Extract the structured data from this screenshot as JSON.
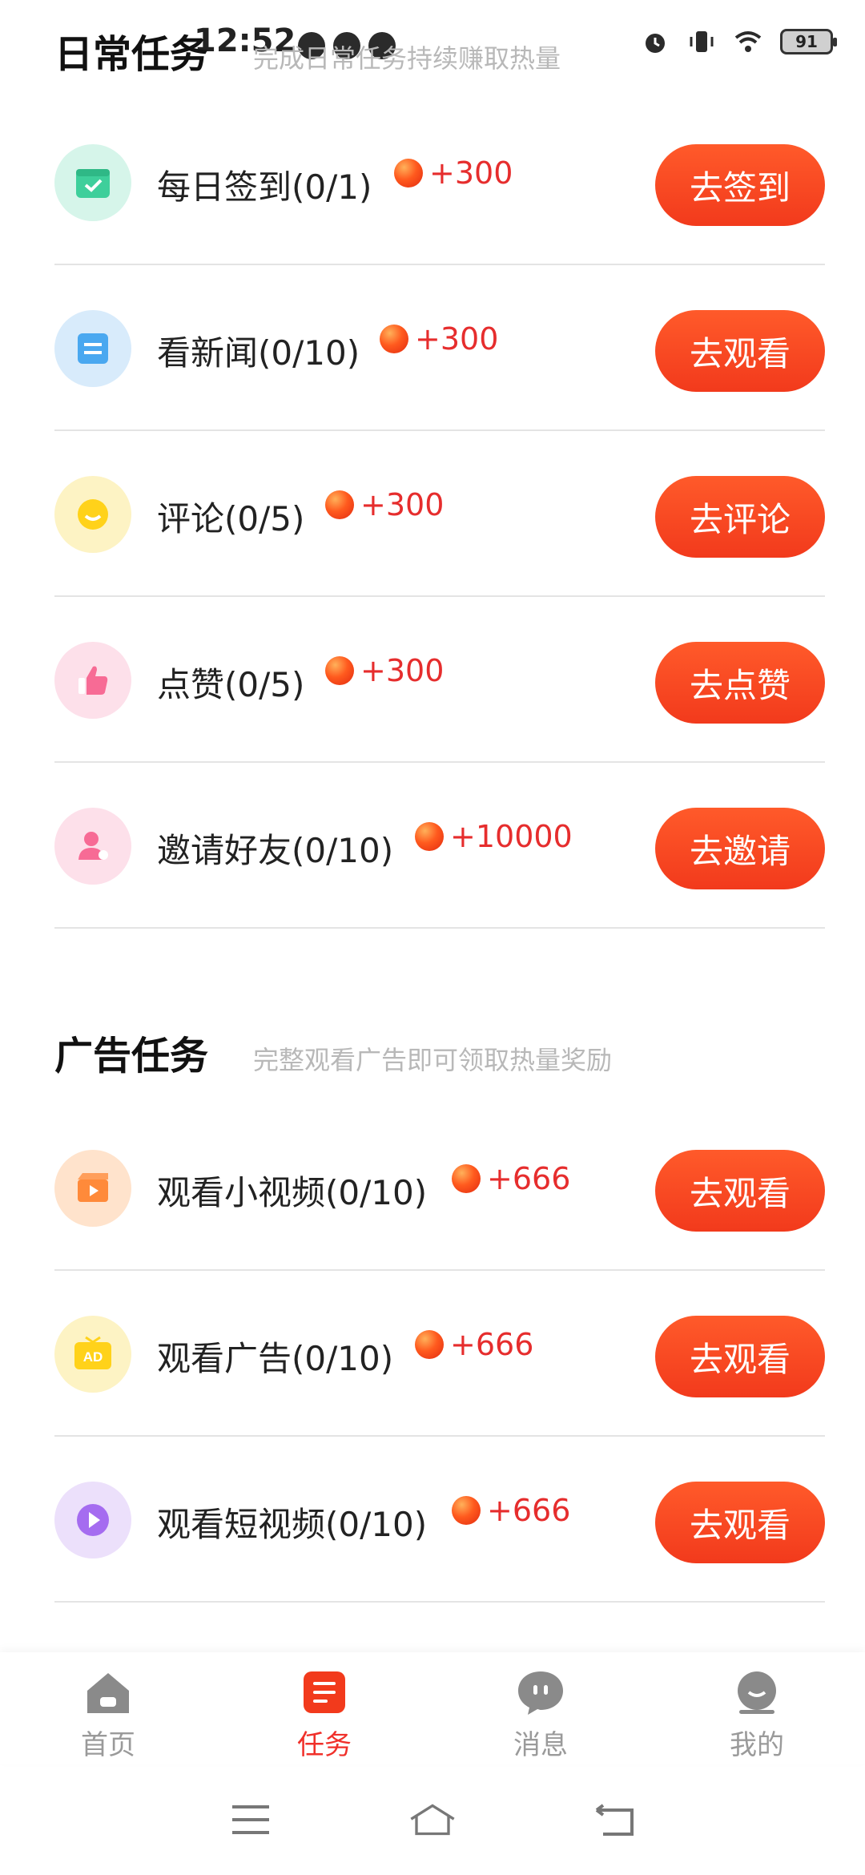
{
  "status_bar": {
    "time": "12:52",
    "battery": "91"
  },
  "daily_section": {
    "title": "日常任务",
    "subtitle": "完成日常任务持续赚取热量"
  },
  "daily_tasks": [
    {
      "name": "每日签到(0/1)",
      "reward": "+300",
      "button": "去签到",
      "icon": "calendar-check-icon",
      "icon_bg": "#d6f5ea",
      "icon_color": "#3ecf9b"
    },
    {
      "name": "看新闻(0/10)",
      "reward": "+300",
      "button": "去观看",
      "icon": "news-icon",
      "icon_bg": "#d8ebfb",
      "icon_color": "#4aa8f0"
    },
    {
      "name": "评论(0/5)",
      "reward": "+300",
      "button": "去评论",
      "icon": "comment-icon",
      "icon_bg": "#fdf3c4",
      "icon_color": "#ffd21a"
    },
    {
      "name": "点赞(0/5)",
      "reward": "+300",
      "button": "去点赞",
      "icon": "thumbs-up-icon",
      "icon_bg": "#fde0ea",
      "icon_color": "#f76b95"
    },
    {
      "name": "邀请好友(0/10)",
      "reward": "+10000",
      "button": "去邀请",
      "icon": "invite-user-icon",
      "icon_bg": "#fde0ea",
      "icon_color": "#f76b95"
    }
  ],
  "ad_section": {
    "title": "广告任务",
    "subtitle": "完整观看广告即可领取热量奖励"
  },
  "ad_tasks": [
    {
      "name": "观看小视频(0/10)",
      "reward": "+666",
      "button": "去观看",
      "icon": "video-clapper-icon",
      "icon_bg": "#ffe3cc",
      "icon_color": "#ff8a3a"
    },
    {
      "name": "观看广告(0/10)",
      "reward": "+666",
      "button": "去观看",
      "icon": "ad-tv-icon",
      "icon_bg": "#fdf3c4",
      "icon_color": "#ffd21a"
    },
    {
      "name": "观看短视频(0/10)",
      "reward": "+666",
      "button": "去观看",
      "icon": "play-circle-icon",
      "icon_bg": "#ece0fb",
      "icon_color": "#a56cf0"
    }
  ],
  "bottom_nav": [
    {
      "label": "首页",
      "icon": "home-icon",
      "active": false
    },
    {
      "label": "任务",
      "icon": "task-list-icon",
      "active": true
    },
    {
      "label": "消息",
      "icon": "message-bubble-icon",
      "active": false
    },
    {
      "label": "我的",
      "icon": "profile-face-icon",
      "active": false
    }
  ],
  "colors": {
    "accent": "#f23a1c",
    "reward_text": "#e62d2d",
    "nav_active": "#f0302a",
    "nav_inactive": "#9a9a9a"
  }
}
